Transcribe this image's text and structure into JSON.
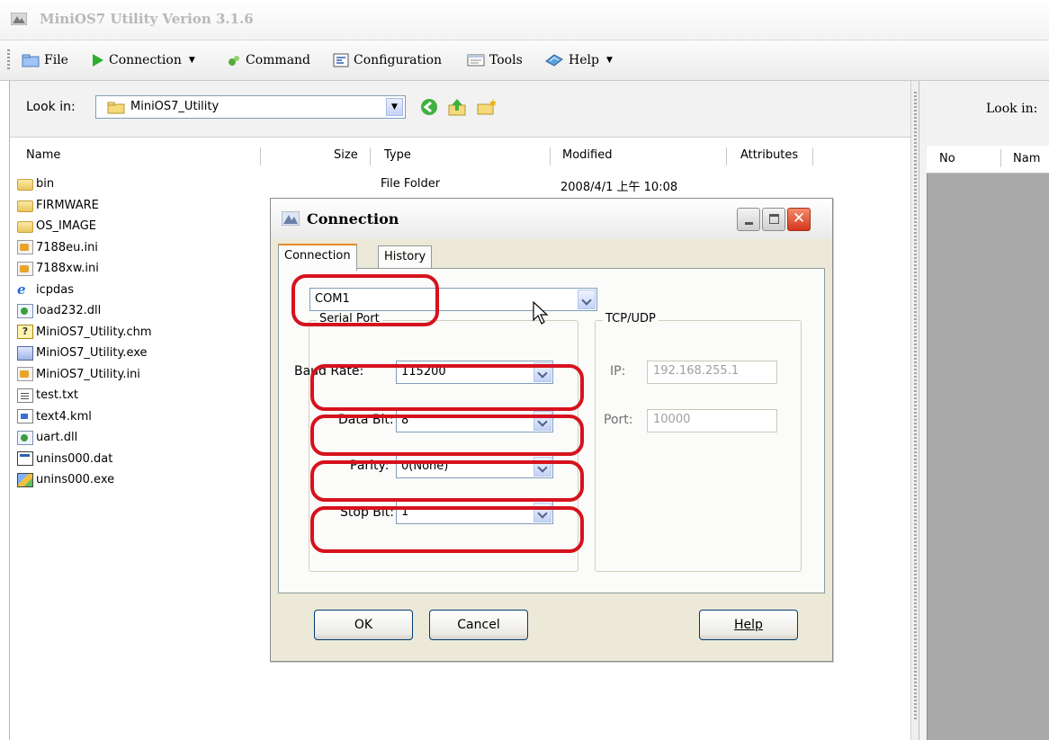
{
  "window": {
    "title": "MiniOS7 Utility Verion 3.1.6"
  },
  "menu": {
    "items": [
      {
        "label": "File"
      },
      {
        "label": "Connection"
      },
      {
        "label": "Command"
      },
      {
        "label": "Configuration"
      },
      {
        "label": "Tools"
      },
      {
        "label": "Help"
      }
    ]
  },
  "left": {
    "look_in_label": "Look in:",
    "look_in_value": "MiniOS7_Utility",
    "columns": [
      "Name",
      "Size",
      "Type",
      "Modified",
      "Attributes"
    ],
    "files": [
      {
        "name": "bin",
        "icon": "folder-icon"
      },
      {
        "name": "FIRMWARE",
        "icon": "folder-icon"
      },
      {
        "name": "OS_IMAGE",
        "icon": "folder-icon"
      },
      {
        "name": "7188eu.ini",
        "icon": "ini-file-icon"
      },
      {
        "name": "7188xw.ini",
        "icon": "ini-file-icon"
      },
      {
        "name": "icpdas",
        "icon": "internet-shortcut-icon"
      },
      {
        "name": "load232.dll",
        "icon": "dll-file-icon"
      },
      {
        "name": "MiniOS7_Utility.chm",
        "icon": "help-file-icon"
      },
      {
        "name": "MiniOS7_Utility.exe",
        "icon": "exe-file-icon"
      },
      {
        "name": "MiniOS7_Utility.ini",
        "icon": "ini-file-icon"
      },
      {
        "name": "test.txt",
        "icon": "text-file-icon"
      },
      {
        "name": "text4.kml",
        "icon": "kml-file-icon"
      },
      {
        "name": "uart.dll",
        "icon": "dll-file-icon"
      },
      {
        "name": "unins000.dat",
        "icon": "dat-file-icon"
      },
      {
        "name": "unins000.exe",
        "icon": "setup-exe-icon"
      }
    ],
    "first_row": {
      "type": "File Folder",
      "modified": "2008/4/1 上午 10:08"
    }
  },
  "right": {
    "look_in_label": "Look in:",
    "columns": [
      "No",
      "Nam"
    ]
  },
  "dialog": {
    "title": "Connection",
    "tabs": [
      "Connection",
      "History"
    ],
    "port": "COM1",
    "serial_group": "Serial Port",
    "tcp_group": "TCP/UDP",
    "baud_label": "Baud Rate:",
    "baud_value": "115200",
    "databit_label": "Data Bit:",
    "databit_value": "8",
    "parity_label": "Parity:",
    "parity_value": "0(None)",
    "stopbit_label": "Stop Bit:",
    "stopbit_value": "1",
    "ip_label": "IP:",
    "ip_value": "192.168.255.1",
    "port_label": "Port:",
    "port_value": "10000",
    "ok": "OK",
    "cancel": "Cancel",
    "help": "Help"
  },
  "colors": {
    "highlight_ring": "#d6121d",
    "tab_accent": "#e68b2c",
    "close_button": "#d4371b"
  }
}
